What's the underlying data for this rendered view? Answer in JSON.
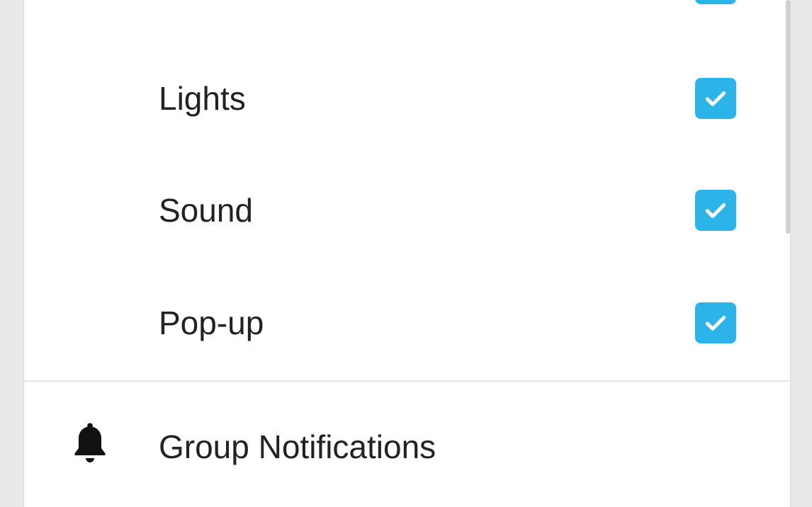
{
  "colors": {
    "accent": "#2cb3e8",
    "text": "#222222",
    "icon": "#111111"
  },
  "notification_options": [
    {
      "label": "Lights",
      "checked": true
    },
    {
      "label": "Sound",
      "checked": true
    },
    {
      "label": "Pop-up",
      "checked": true
    }
  ],
  "group_notifications": {
    "label": "Group Notifications",
    "icon": "bell-icon"
  }
}
